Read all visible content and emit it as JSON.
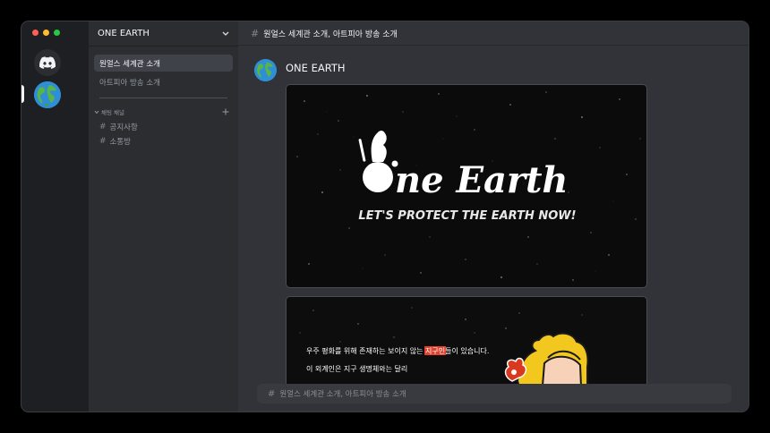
{
  "window": {
    "traffic_lights": [
      "#ff5f57",
      "#febc2e",
      "#28c840"
    ]
  },
  "rail": {
    "home_icon": "discord-logo-icon",
    "server_icon": "earth-globe-icon"
  },
  "sidebar": {
    "guild_name": "ONE EARTH",
    "items": [
      {
        "label": "원얼스 세계관 소개",
        "active": true
      },
      {
        "label": "아트피아 방송 소개",
        "active": false
      }
    ],
    "category": "채팅 채널",
    "channels": [
      {
        "label": "공지사항"
      },
      {
        "label": "소통방"
      }
    ]
  },
  "topbar": {
    "channel_title": "원얼스 세계관 소개, 아트피아 방송 소개"
  },
  "message": {
    "author": "ONE EARTH",
    "banner": {
      "title_text": "ne Earth",
      "tagline": "LET'S PROTECT THE EARTH NOW!"
    },
    "embed2": {
      "line1_a": "우주 평화를 위해 존재하는 보이지 않는 ",
      "line1_hl": "지구인",
      "line1_b": "들이 있습니다.",
      "line2": "이 외계인은 지구 생명체와는 달리"
    }
  },
  "composer": {
    "placeholder": "원얼스 세계관 소개, 아트피아 방송 소개"
  },
  "colors": {
    "accent_highlight": "#e0422f",
    "bg_main": "#313338",
    "bg_sidebar": "#2b2d31",
    "bg_rail": "#1e1f22"
  }
}
